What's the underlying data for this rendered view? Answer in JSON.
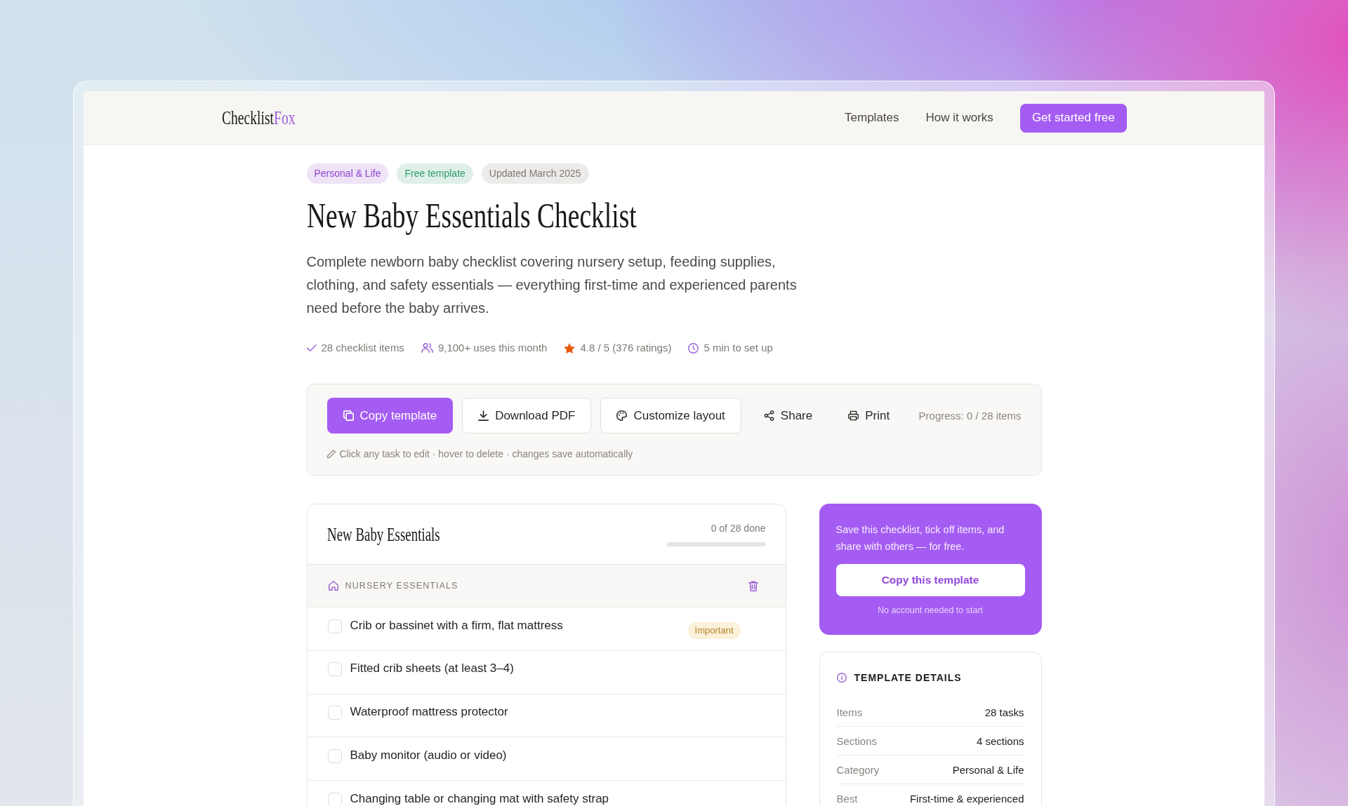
{
  "header": {
    "logo": {
      "part_1": "Checklist",
      "part_2": "Fox"
    },
    "nav": [
      "Templates",
      "How it works"
    ],
    "cta": "Get started free"
  },
  "tags": [
    {
      "label": "Personal & Life",
      "color": "#8e44cc"
    },
    {
      "label": "Free template",
      "color": "#2e9a6d"
    },
    {
      "label": "Updated March 2025",
      "color": "#7d7873"
    }
  ],
  "title": "New Baby Essentials Checklist",
  "description": "Complete newborn baby checklist covering nursery setup, feeding supplies, clothing, and safety essentials — everything first-time and experienced parents need before the baby arrives.",
  "stats": [
    {
      "kind": "items",
      "text": "28 checklist items"
    },
    {
      "kind": "users",
      "text": "9,100+ uses this month"
    },
    {
      "kind": "rating",
      "text": "4.8 / 5 (376 ratings)"
    },
    {
      "kind": "duration",
      "text": "5 min to set up"
    }
  ],
  "toolbar": {
    "buttons": [
      {
        "kind": "copy",
        "label": "Copy template"
      },
      {
        "kind": "download",
        "label": "Download PDF"
      },
      {
        "kind": "customize",
        "label": "Customize layout"
      },
      {
        "kind": "share",
        "label": "Share"
      },
      {
        "kind": "print",
        "label": "Print"
      }
    ],
    "progress": "Progress: 0 / 28 items",
    "hint": "Click any task to edit · hover to delete · changes save automatically"
  },
  "checklist": {
    "title": "New Baby Essentials",
    "done": "0 of 28 done",
    "level": 0,
    "sections": [
      {
        "title": "NURSERY ESSENTIALS",
        "items": [
          {
            "text": "Crib or bassinet with a firm, flat mattress",
            "checked": false,
            "badge": "Important"
          },
          {
            "text": "Fitted crib sheets (at least 3–4)",
            "checked": false
          },
          {
            "text": "Waterproof mattress protector",
            "checked": false
          },
          {
            "text": "Baby monitor (audio or video)",
            "checked": false
          },
          {
            "text": "Changing table or changing mat with safety strap",
            "checked": false
          }
        ]
      }
    ]
  },
  "promo": {
    "text": "Save this checklist, tick off items, and share with others — for free.",
    "button": "Copy this template",
    "note": "No account needed to start"
  },
  "details": {
    "title": "TEMPLATE DETAILS",
    "rows": [
      {
        "label": "Items",
        "value": "28 tasks"
      },
      {
        "label": "Sections",
        "value": "4 sections"
      },
      {
        "label": "Category",
        "value": "Personal & Life"
      },
      {
        "label": "Best",
        "value": "First-time & experienced"
      }
    ]
  }
}
